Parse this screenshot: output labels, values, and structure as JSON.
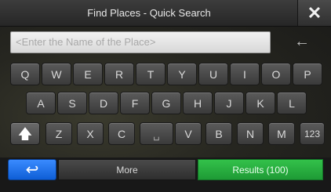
{
  "window": {
    "title": "Find Places - Quick Search",
    "close_glyph": "✕"
  },
  "search": {
    "placeholder": "<Enter the Name of the Place>",
    "value": "",
    "backspace_glyph": "←"
  },
  "keyboard": {
    "row1": [
      "Q",
      "W",
      "E",
      "R",
      "T",
      "Y",
      "U",
      "I",
      "O",
      "P"
    ],
    "row2": [
      "A",
      "S",
      "D",
      "F",
      "G",
      "H",
      "J",
      "K",
      "L"
    ],
    "row3": {
      "shift": "🡅",
      "keys": [
        "Z",
        "X",
        "C"
      ],
      "space": "␣",
      "keys2": [
        "V",
        "B",
        "N",
        "M"
      ],
      "numeric": "123"
    }
  },
  "bottom": {
    "back_glyph": "↩",
    "more_label": "More",
    "results_label": "Results (100)"
  },
  "colors": {
    "back_button": "#1f6fe6",
    "results_button": "#2bb040"
  }
}
